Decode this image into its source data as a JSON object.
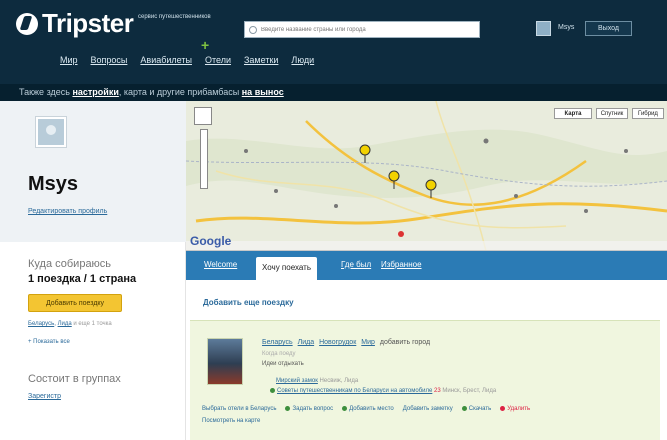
{
  "header": {
    "logo": "Tripster",
    "tagline": "сервис путешественников",
    "search_placeholder": "Введите название страны или города",
    "user_name": "Msys",
    "logout_label": "Выход"
  },
  "nav": {
    "items": [
      "Мир",
      "Вопросы",
      "Авиабилеты",
      "Отели",
      "Заметки",
      "Люди"
    ]
  },
  "promo": {
    "prefix": "Также здесь",
    "link1": "настройки",
    "middle": ", карта и другие прибамбасы",
    "link2": "на вынос"
  },
  "profile": {
    "name": "Msys",
    "edit_link": "Редактировать профиль",
    "going_label": "Куда собираюсь",
    "going_value": "1 поездка / 1 страна",
    "add_trip_button": "Добавить поездку",
    "link_a": "Беларусь",
    "link_b": "Лида",
    "link_muted": "и еще 1 точка",
    "show_all": "+ Показать все",
    "groups_label": "Состоит в группах",
    "groups_link": "Зарегистр"
  },
  "map": {
    "type_map": "Карта",
    "type_sat": "Спутник",
    "type_hybrid": "Гибрид",
    "logo": "Google"
  },
  "tabs": [
    "Welcome",
    "Хочу поехать",
    "Где был",
    "Избранное"
  ],
  "add_your_trip": "Добавить еще поездку",
  "trip": {
    "places": [
      "Беларусь",
      "Лида",
      "Новогрудок",
      "Мир"
    ],
    "add_city": "добавить город",
    "subtitle": "Когда поеду",
    "subtitle2": "Идеи отдыхать",
    "line1_link": "Мирский замок",
    "line1_muted": "Несвиж, Лида",
    "line2_link": "Советы путешественникам по Беларуси на автомобиле",
    "line2_num": "23",
    "line2_muted": "Минск, Брест, Лида",
    "actions": [
      "Выбрать отели в Беларусь",
      "Задать вопрос",
      "Добавить место",
      "Добавить заметку",
      "Скачать",
      "Удалить"
    ],
    "actions2": "Посмотреть на карте"
  }
}
